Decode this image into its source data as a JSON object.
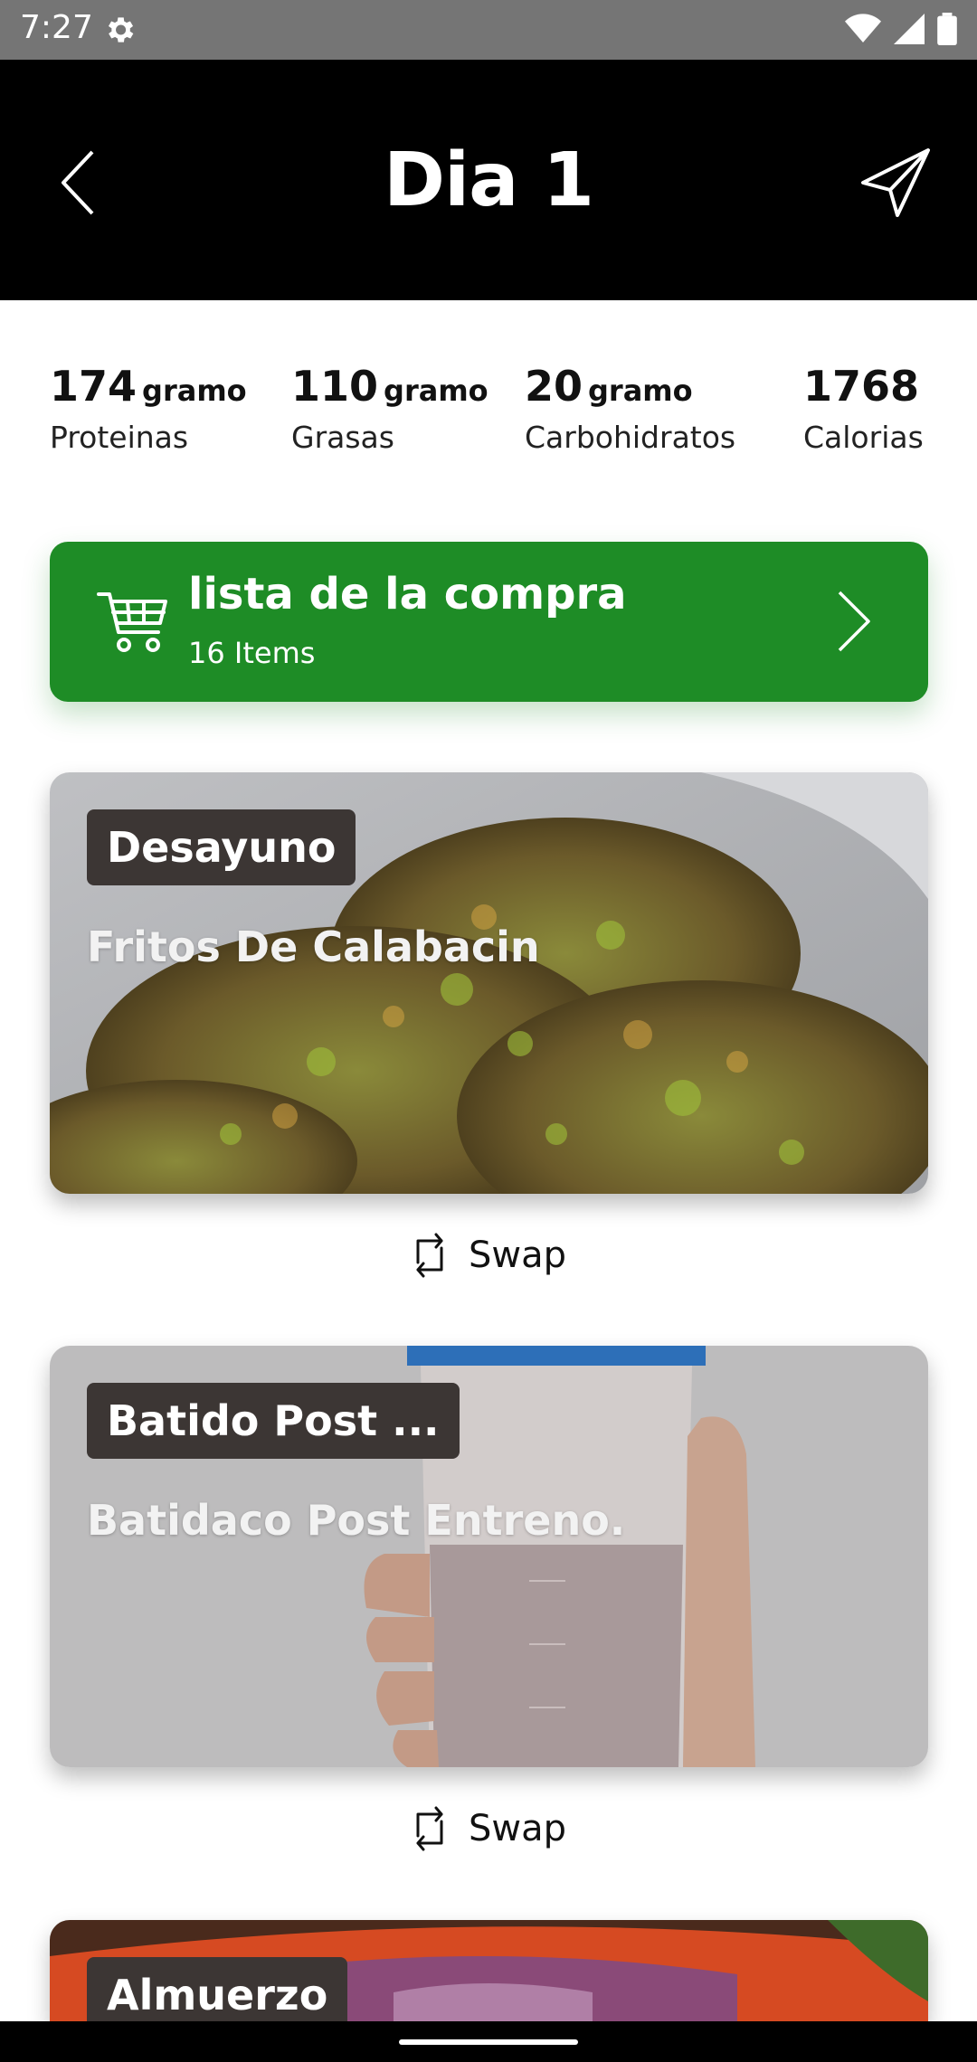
{
  "status_bar": {
    "time": "7:27",
    "icons": [
      "gear-icon",
      "wifi-icon",
      "signal-icon",
      "battery-icon"
    ]
  },
  "header": {
    "title": "Dia 1",
    "back_icon": "chevron-left-icon",
    "share_icon": "send-icon",
    "background": "#000000"
  },
  "macros": [
    {
      "value": "174",
      "unit": "gramo",
      "label": "Proteinas"
    },
    {
      "value": "110",
      "unit": "gramo",
      "label": "Grasas"
    },
    {
      "value": "20",
      "unit": "gramo",
      "label": "Carbohidratos"
    },
    {
      "value": "1768",
      "unit": "",
      "label": "Calorias"
    }
  ],
  "shopping_list": {
    "title": "lista de la compra",
    "count": "16 Items",
    "color": "#1e8c26",
    "icon": "shopping-cart-icon"
  },
  "meals": [
    {
      "badge": "Desayuno",
      "name": "Fritos De Calabacin",
      "swap_label": "Swap"
    },
    {
      "badge": "Batido Post ...",
      "name": "Batidaco Post Entreno.",
      "swap_label": "Swap"
    },
    {
      "badge": "Almuerzo",
      "name": "",
      "swap_label": ""
    }
  ]
}
